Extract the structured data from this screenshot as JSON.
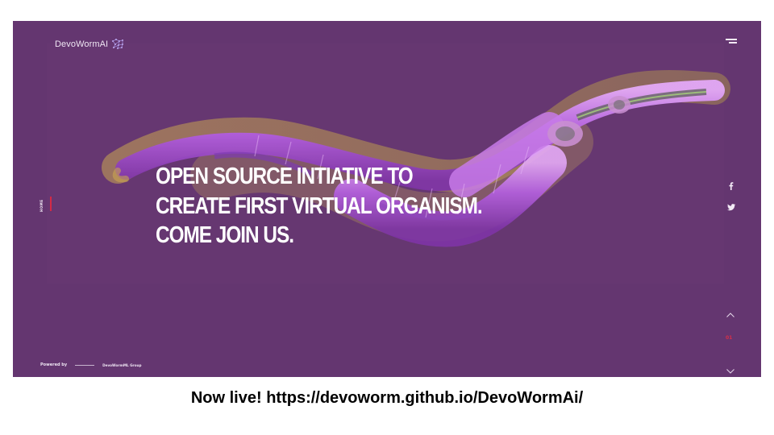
{
  "site": {
    "brand_name": "DevoWormAI",
    "headline_lines": [
      "OPEN SOURCE INTIATIVE TO",
      "CREATE FIRST VIRTUAL ORGANISM.",
      "COME JOIN US."
    ],
    "nav_vertical_label": "HOME",
    "powered_by_label": "Powered by",
    "powered_by_group": "DevoWormML Group",
    "page_indicator": "01",
    "colors": {
      "background": "#643670",
      "accent": "#d42a45",
      "worm_body": "#b25ae0",
      "worm_halo": "#c7a24a"
    },
    "icons": {
      "menu": "hamburger-menu-icon",
      "facebook": "facebook-icon",
      "twitter": "twitter-icon",
      "up": "chevron-up-icon",
      "down": "chevron-down-icon",
      "logo": "neural-network-logo-icon"
    }
  },
  "caption": {
    "text": "Now live! https://devoworm.github.io/DevoWormAi/"
  }
}
